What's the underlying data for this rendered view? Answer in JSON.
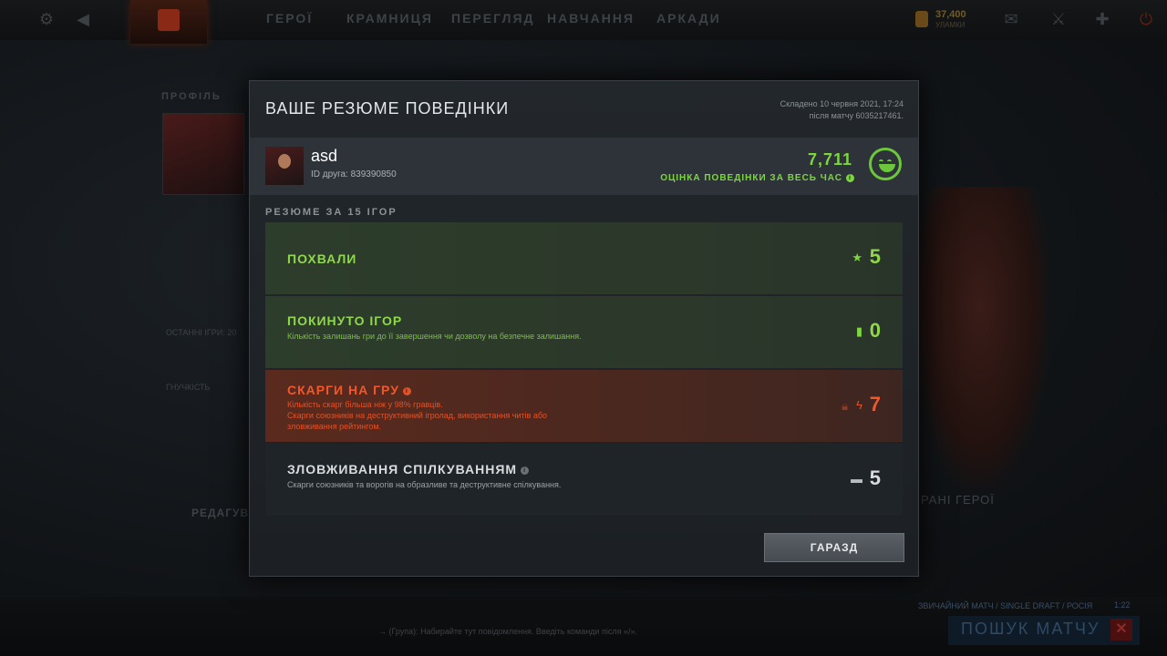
{
  "topbar": {
    "nav": [
      "ГЕРОЇ",
      "КРАМНИЦЯ",
      "ПЕРЕГЛЯД",
      "НАВЧАННЯ",
      "АРКАДИ"
    ],
    "gold_amount": "37,400",
    "gold_label": "УЛАМКИ"
  },
  "background": {
    "profile_label": "ПРОФІЛЬ",
    "edit_label": "РЕДАГУВАТ",
    "last_games": "ОСТАННІ ІГРИ: 20",
    "flex_label": "ГНУЧКІСТЬ",
    "heroes_label": "РАНІ ГЕРОЇ",
    "find_match": "ПОШУК МАТЧУ",
    "match_mode": "ЗВИЧАЙНИЙ МАТЧ / SINGLE DRAFT / РОСІЯ",
    "match_time": "1:22",
    "chat_placeholder": "→ (Група): Набирайте тут повідомлення. Введіть команди після «/»."
  },
  "modal": {
    "title": "ВАШЕ РЕЗЮМЕ ПОВЕДІНКИ",
    "date_line1": "Складено 10 червня 2021, 17:24",
    "date_line2": "після матчу 6035217461.",
    "user": {
      "name": "asd",
      "friend_id": "ID друга: 839390850"
    },
    "score": "7,711",
    "score_label": "ОЦІНКА ПОВЕДІНКИ ЗА ВЕСЬ ЧАС",
    "section_header": "РЕЗЮМЕ ЗА 15 ІГОР",
    "rows": [
      {
        "title": "ПОХВАЛИ",
        "desc": "",
        "value": "5",
        "icon": "star-icon"
      },
      {
        "title": "ПОКИНУТО ІГОР",
        "desc": "Кількість залишань гри до її завершення чи дозволу на безпечне залишання.",
        "value": "0",
        "icon": "door-icon"
      },
      {
        "title": "СКАРГИ НА ГРУ",
        "desc1": "Кількість скарг більша ніж у 98% гравців.",
        "desc2": "Скарги союзників на деструктивний ігролад, використання читів або зловживання рейтингом.",
        "value": "7",
        "icon": "lightning-icon"
      },
      {
        "title": "ЗЛОВЖИВАННЯ СПІЛКУВАННЯМ",
        "desc": "Скарги союзників та ворогів на образливе та деструктивне спілкування.",
        "value": "5",
        "icon": "chat-bubble-icon"
      }
    ],
    "ok_button": "ГАРАЗД"
  },
  "colors": {
    "green": "#7dd640",
    "red": "#e0522a",
    "accent_gold": "#6e5a2a"
  }
}
